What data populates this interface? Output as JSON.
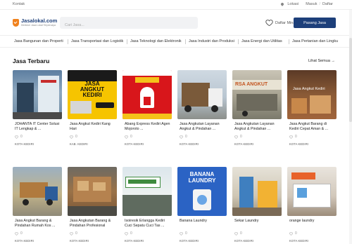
{
  "topbar": {
    "contact": "Kontak",
    "location": "Lokasi",
    "login": "Masuk",
    "separator": "/",
    "register": "Daftar"
  },
  "header": {
    "logo_name": "Jasalokal.com",
    "logo_tagline": "Direktori Jasa Lokal Terpercaya",
    "search_placeholder": "Cari Jasa...",
    "wishlist": "Daftar Minat",
    "post_service": "Pasang Jasa"
  },
  "categories": [
    "Jasa Bangunan dan Properti",
    "Jasa Transportasi dan Logistik",
    "Jasa Teknologi dan Elektronik",
    "Jasa Industri dan Produksi",
    "Jasa Energi dan Utilitas",
    "Jasa Pertanian dan Lingku"
  ],
  "section": {
    "title": "Jasa Terbaru",
    "see_all": "Lihat Semua →"
  },
  "colors": {
    "brand": "#1d3f7a",
    "accent": "#f0821e"
  },
  "cards": [
    {
      "title": "JOHANTA IT Center Solusi IT Lengkap & ...",
      "rating": "0",
      "location": "KOTA KEDIRI",
      "thumb_text": ""
    },
    {
      "title": "Jasa Angkut Kediri Kang Hari",
      "rating": "0",
      "location": "KAB. KEDIRI",
      "thumb_text": "JASA ANGKUT KEDIRI"
    },
    {
      "title": "Abang Express Kediri Agen Mojoroto ...",
      "rating": "0",
      "location": "KOTA KEDIRI",
      "thumb_text": ""
    },
    {
      "title": "Jasa Angkutan Layanan Angkut & Pindahan ...",
      "rating": "0",
      "location": "KOTA KEDIRI",
      "thumb_text": ""
    },
    {
      "title": "Jasa Angkutan Layanan Angkut & Pindahan ...",
      "rating": "0",
      "location": "KOTA KEDIRI",
      "thumb_text": "RSA ANGKUT"
    },
    {
      "title": "Jasa Angkut Barang di Kediri Cepat Aman & ...",
      "rating": "0",
      "location": "KOTA KEDIRI",
      "thumb_text": "Jasa Angkut Kediri"
    },
    {
      "title": "Jasa Angkut Barang & Pindahan Rumah Kos ...",
      "rating": "0",
      "location": "KOTA KEDIRI",
      "thumb_text": ""
    },
    {
      "title": "Jasa Angkutan Barang & Pindahan Profesional",
      "rating": "0",
      "location": "KOTA KEDIRI",
      "thumb_text": ""
    },
    {
      "title": "Isoiresik Erlangga Kediri Cuci Sepatu Cuci Tas ...",
      "rating": "0",
      "location": "KOTA KEDIRI",
      "thumb_text": ""
    },
    {
      "title": "Banana Laundry",
      "rating": "0",
      "location": "KOTA KEDIRI",
      "thumb_text": "BANANA LAUNDRY"
    },
    {
      "title": "Sekar Laundry",
      "rating": "0",
      "location": "KOTA KEDIRI",
      "thumb_text": ""
    },
    {
      "title": "orange laundry",
      "rating": "0",
      "location": "KOTA KEDIRI",
      "thumb_text": ""
    }
  ]
}
